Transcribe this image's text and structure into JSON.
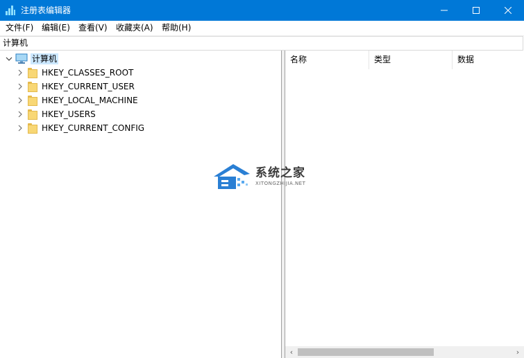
{
  "window": {
    "title": "注册表编辑器",
    "accent": "#0078d7"
  },
  "menu": [
    {
      "label": "文件(F)"
    },
    {
      "label": "编辑(E)"
    },
    {
      "label": "查看(V)"
    },
    {
      "label": "收藏夹(A)"
    },
    {
      "label": "帮助(H)"
    }
  ],
  "address": "计算机",
  "tree": {
    "root": {
      "label": "计算机",
      "icon": "computer-icon",
      "expanded": true
    },
    "keys": [
      {
        "label": "HKEY_CLASSES_ROOT",
        "icon": "folder-icon"
      },
      {
        "label": "HKEY_CURRENT_USER",
        "icon": "folder-icon"
      },
      {
        "label": "HKEY_LOCAL_MACHINE",
        "icon": "folder-icon"
      },
      {
        "label": "HKEY_USERS",
        "icon": "folder-icon"
      },
      {
        "label": "HKEY_CURRENT_CONFIG",
        "icon": "folder-icon"
      }
    ]
  },
  "list": {
    "columns": [
      "名称",
      "类型",
      "数据"
    ]
  },
  "watermark": {
    "title": "系统之家",
    "subtitle": "XITONGZHIJIA.NET"
  }
}
